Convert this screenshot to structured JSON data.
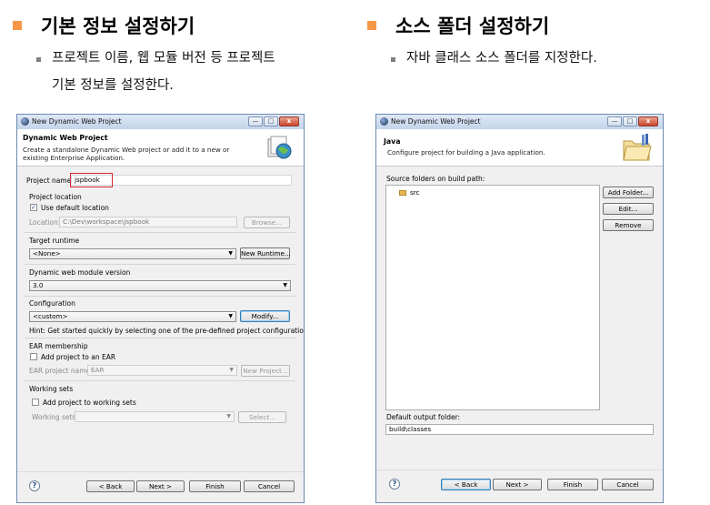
{
  "left": {
    "heading": "기본 정보 설정하기",
    "bullet_line1": "프로젝트 이름, 웹 모듈 버전 등 프로젝트",
    "bullet_line2": "기본 정보를 설정한다.",
    "dialog": {
      "window_title": "New Dynamic Web Project",
      "min_btn": "—",
      "max_btn": "□",
      "close_btn": "x",
      "header_title": "Dynamic Web Project",
      "header_desc": "Create a standalone Dynamic Web project or add it to a new or existing Enterprise Application.",
      "project_name_label": "Project name:",
      "project_name_value": "jspbook",
      "project_location_label": "Project location",
      "use_default_location": "Use default location",
      "location_label": "Location:",
      "location_value": "C:\\Dev\\workspace\\jspbook",
      "browse_button": "Browse...",
      "target_runtime_label": "Target runtime",
      "target_runtime_value": "<None>",
      "new_runtime_button": "New Runtime...",
      "module_version_label": "Dynamic web module version",
      "module_version_value": "3.0",
      "configuration_label": "Configuration",
      "configuration_value": "<custom>",
      "modify_button": "Modify...",
      "hint_text": "Hint: Get started quickly by selecting one of the pre-defined project configurations.",
      "ear_label": "EAR membership",
      "add_to_ear": "Add project to an EAR",
      "ear_project_name_label": "EAR project name:",
      "ear_project_name_value": "EAR",
      "new_project_button": "New Project...",
      "working_sets_label": "Working sets",
      "add_to_working_sets": "Add project to working sets",
      "working_sets_field_label": "Working sets:",
      "select_button": "Select...",
      "help": "?",
      "back_button": "< Back",
      "next_button": "Next >",
      "finish_button": "Finish",
      "cancel_button": "Cancel"
    }
  },
  "right": {
    "heading": "소스 폴더 설정하기",
    "bullet_line1": "자바 클래스 소스 폴더를 지정한다.",
    "dialog": {
      "window_title": "New Dynamic Web Project",
      "min_btn": "—",
      "max_btn": "□",
      "close_btn": "x",
      "header_title": "Java",
      "header_desc": "Configure project for building a Java application.",
      "source_folders_label": "Source folders on build path:",
      "source_item": "src",
      "add_folder_button": "Add Folder...",
      "edit_button": "Edit...",
      "remove_button": "Remove",
      "default_output_label": "Default output folder:",
      "default_output_value": "build\\classes",
      "help": "?",
      "back_button": "< Back",
      "next_button": "Next >",
      "finish_button": "Finish",
      "cancel_button": "Cancel"
    }
  },
  "colors": {
    "heading_square": "#f79646",
    "highlight_box": "#d9272e",
    "title_bar": "#c3d4ea"
  }
}
